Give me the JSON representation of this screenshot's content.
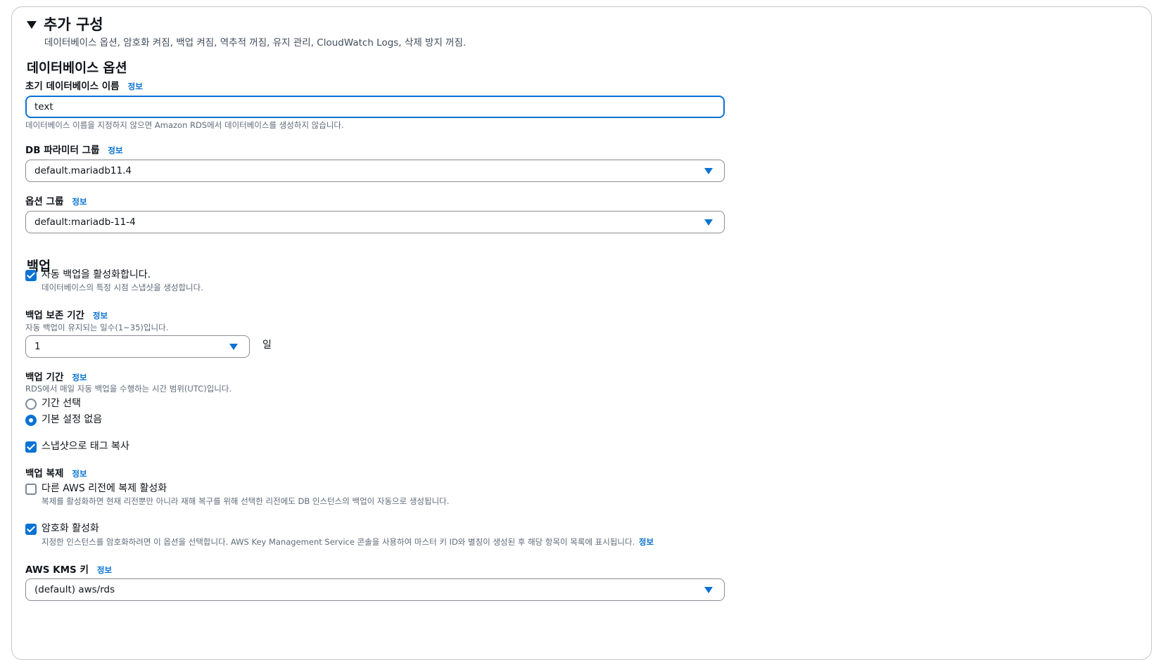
{
  "section": {
    "title": "추가 구성",
    "summary": "데이터베이스 옵션, 암호화 켜짐, 백업 켜짐, 역추적 꺼짐, 유지 관리, CloudWatch Logs, 삭제 방지 꺼짐."
  },
  "info_label": "정보",
  "db_options": {
    "heading": "데이터베이스 옵션",
    "initial_db_name": {
      "label": "초기 데이터베이스 이름",
      "value": "text",
      "hint": "데이터베이스 이름을 지정하지 않으면 Amazon RDS에서 데이터베이스를 생성하지 않습니다."
    },
    "param_group": {
      "label": "DB 파라미터 그룹",
      "value": "default.mariadb11.4"
    },
    "option_group": {
      "label": "옵션 그룹",
      "value": "default:mariadb-11-4"
    }
  },
  "backup": {
    "heading": "백업",
    "enable_auto": {
      "label": "자동 백업을 활성화합니다.",
      "hint": "데이터베이스의 특정 시점 스냅샷을 생성합니다.",
      "checked": true
    },
    "retention": {
      "label": "백업 보존 기간",
      "hint": "자동 백업이 유지되는 일수(1~35)입니다.",
      "value": "1",
      "unit": "일"
    },
    "window": {
      "label": "백업 기간",
      "hint": "RDS에서 매일 자동 백업을 수행하는 시간 범위(UTC)입니다.",
      "options": [
        "기간 선택",
        "기본 설정 없음"
      ],
      "selected": "기본 설정 없음"
    },
    "copy_tags": {
      "label": "스냅샷으로 태그 복사",
      "checked": true
    },
    "replication": {
      "label": "백업 복제",
      "enable_label": "다른 AWS 리전에 복제 활성화",
      "hint": "복제를 활성화하면 현재 리전뿐만 아니라 재해 복구를 위해 선택한 리전에도 DB 인스턴스의 백업이 자동으로 생성됩니다.",
      "checked": false
    }
  },
  "encryption": {
    "enable_label": "암호화 활성화",
    "hint": "지정한 인스턴스를 암호화하려면 이 옵션을 선택합니다. AWS Key Management Service 콘솔을 사용하여 마스터 키 ID와 별칭이 생성된 후 해당 항목이 목록에 표시됩니다.",
    "checked": true,
    "kms_key": {
      "label": "AWS KMS 키",
      "value": "(default) aws/rds"
    }
  },
  "colors": {
    "accent": "#0972d3",
    "text": "#0f141a",
    "muted": "#5f6b7a",
    "border": "#8c8c94"
  }
}
